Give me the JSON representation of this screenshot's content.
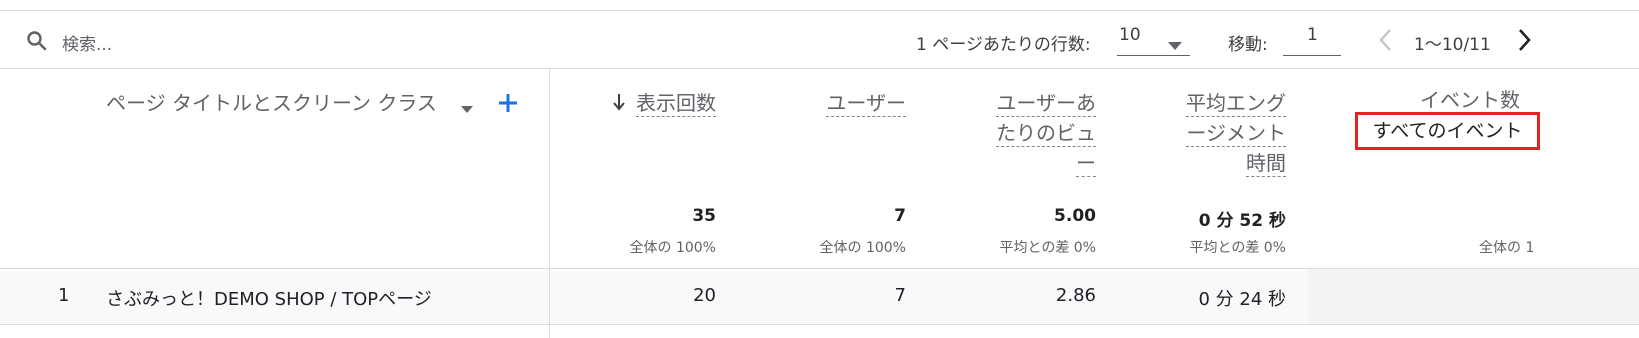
{
  "toolbar": {
    "search_placeholder": "検索...",
    "rows_per_page_label": "1 ページあたりの行数:",
    "rows_per_page_value": "10",
    "goto_label": "移動:",
    "goto_value": "1",
    "range": "1〜10/11"
  },
  "columns": {
    "dimension": "ページ タイトルとスクリーン クラス",
    "views": "表示回数",
    "users": "ユーザー",
    "views_per_user": [
      "ユーザーあ",
      "たりのビュ",
      "ー"
    ],
    "avg_engagement": [
      "平均エング",
      "ージメント",
      "時間"
    ],
    "event_count": "イベント数",
    "event_filter": "すべてのイベント"
  },
  "totals": {
    "views": "35",
    "views_sub": "全体の 100%",
    "users": "7",
    "users_sub": "全体の 100%",
    "views_per_user": "5.00",
    "views_per_user_sub": "平均との差 0%",
    "avg_engagement": "0 分 52 秒",
    "avg_engagement_sub": "平均との差 0%",
    "event_count_sub": "全体の 1"
  },
  "rows": [
    {
      "index": "1",
      "title": "さぶみっと！DEMO SHOP / TOPページ",
      "views": "20",
      "users": "7",
      "views_per_user": "2.86",
      "avg_engagement": "0 分 24 秒"
    }
  ],
  "colors": {
    "highlight_border": "#e02424",
    "accent_blue": "#1a73e8",
    "row_bg": "#f8f9fa",
    "event_cell_bg": "#f1f3f4"
  }
}
